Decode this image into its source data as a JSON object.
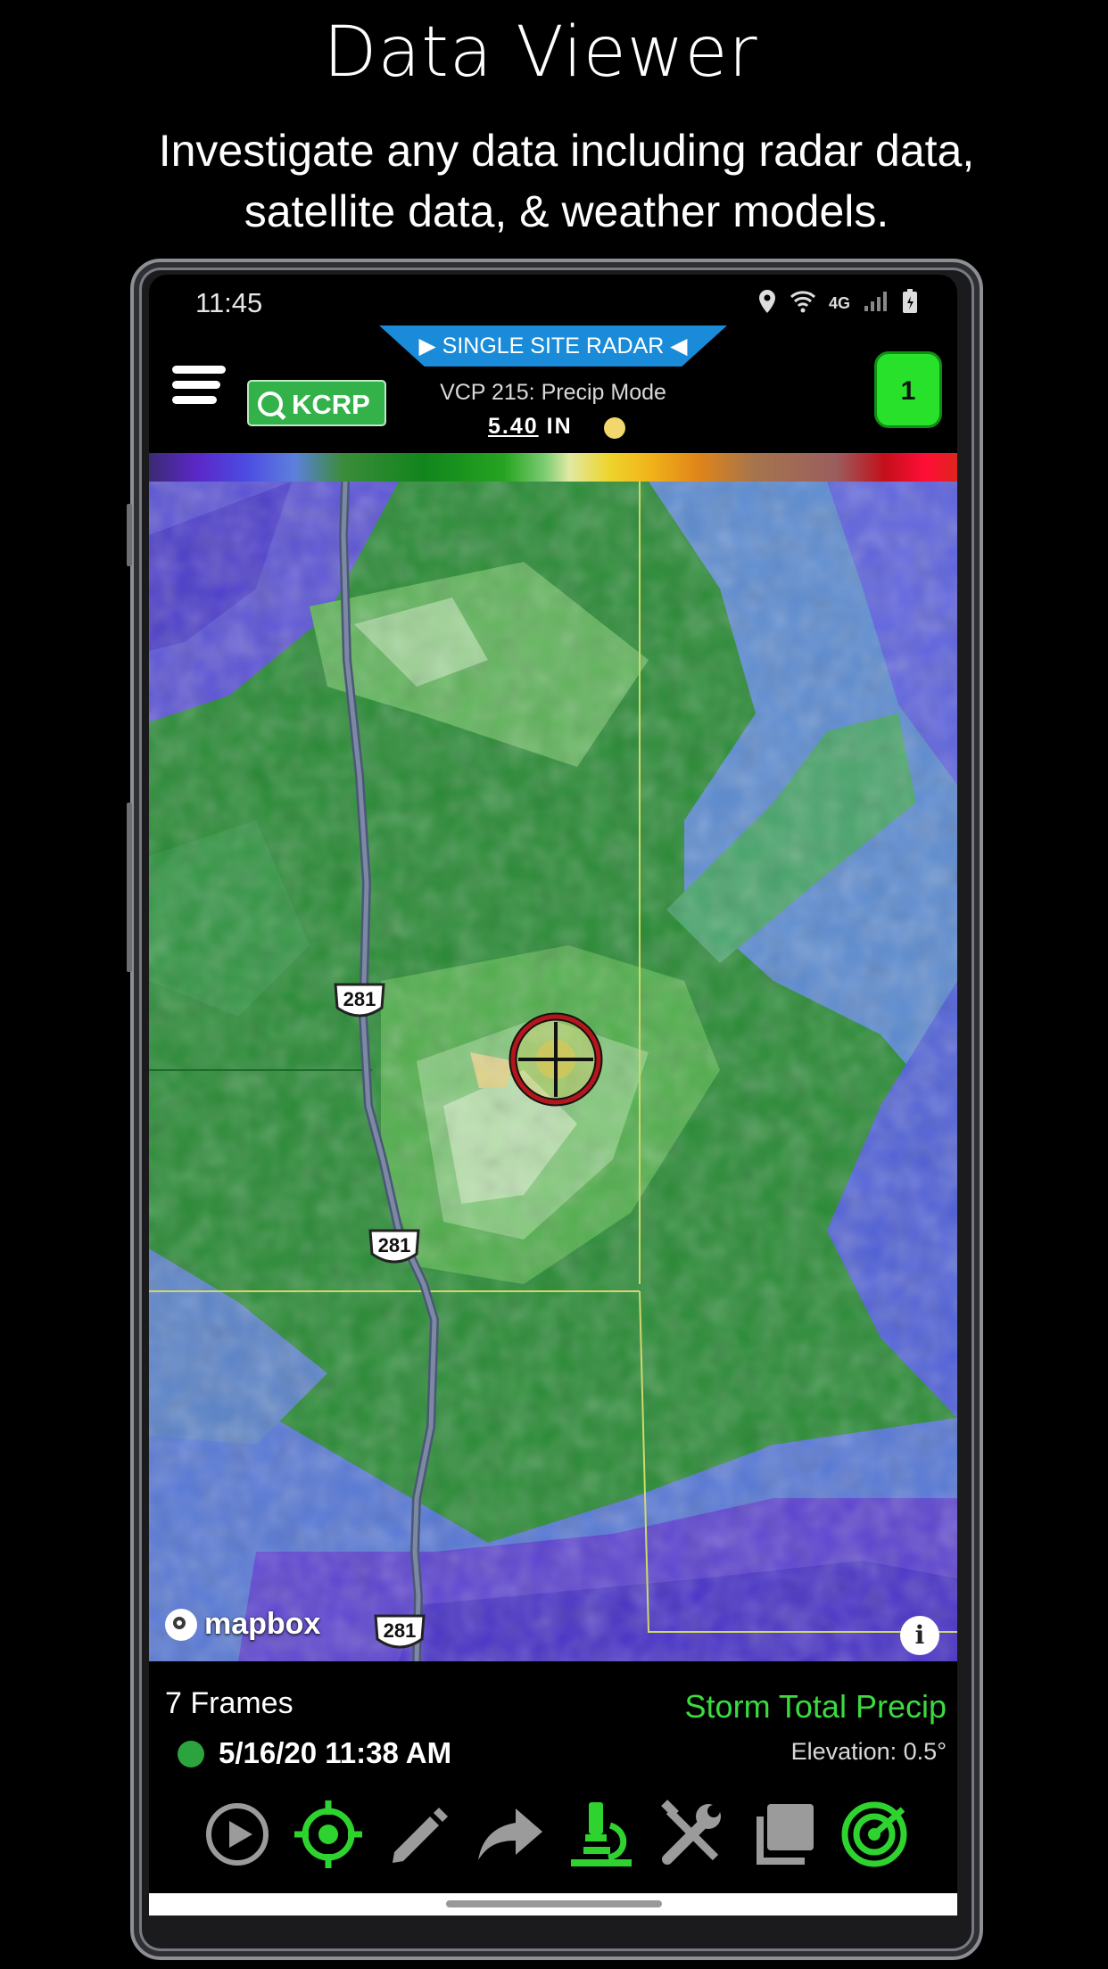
{
  "promo": {
    "title": "Data Viewer",
    "subtitle": "Investigate any data including radar data, satellite data, & weather models."
  },
  "statusbar": {
    "time": "11:45",
    "network": "4G"
  },
  "header": {
    "mode_banner": "SINGLE SITE RADAR",
    "site_code": "KCRP",
    "vcp_text": "VCP 215: Precip Mode",
    "value_number": "5.40",
    "value_unit": "IN",
    "counter": "1"
  },
  "map": {
    "highway_labels": [
      "281",
      "281",
      "281"
    ],
    "attribution": "mapbox",
    "info_glyph": "i"
  },
  "bottom": {
    "frames": "7 Frames",
    "product": "Storm Total Precip",
    "timestamp": "5/16/20 11:38 AM",
    "elevation": "Elevation: 0.5°"
  },
  "toolbar": {
    "items": [
      "play-icon",
      "target-icon",
      "pencil-icon",
      "share-icon",
      "microscope-icon",
      "tools-icon",
      "layers-icon",
      "radar-icon"
    ]
  },
  "colors": {
    "accent": "#27e12a",
    "banner": "#1a8bd8",
    "product_text": "#3bdb3f"
  }
}
